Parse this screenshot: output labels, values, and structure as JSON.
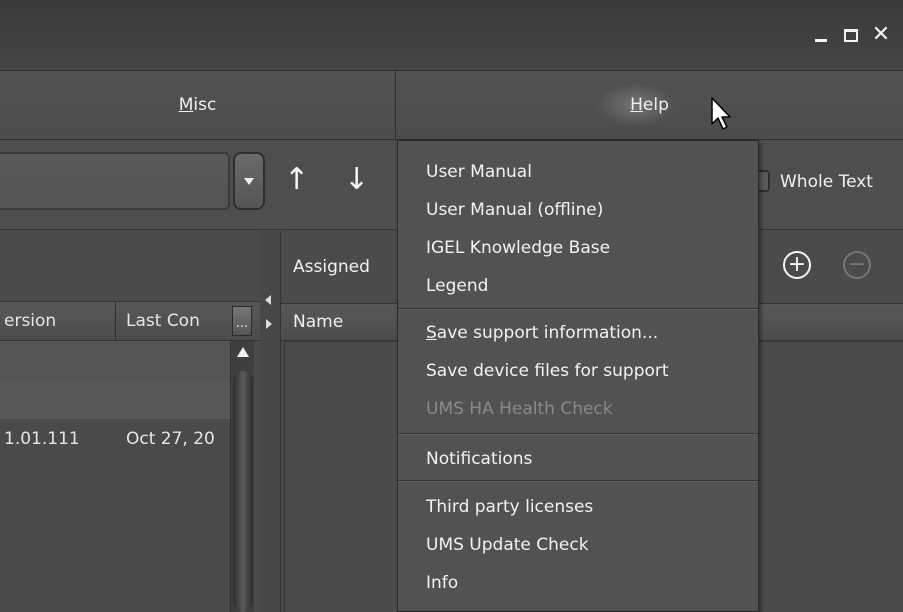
{
  "window": {
    "controls": {
      "minimize_icon": "minimize-icon",
      "maximize_icon": "maximize-icon",
      "close_glyph": "✕"
    }
  },
  "menubar": {
    "misc_label": "Misc",
    "help_label": "Help"
  },
  "toolbar": {
    "search_value": "",
    "up_arrow": "↑",
    "down_arrow": "↓",
    "whole_text_label": "Whole Text"
  },
  "left_table": {
    "columns": {
      "version": "ersion",
      "last_contact": "Last Con",
      "more": "..."
    },
    "row": {
      "version": "1.01.111",
      "date": "Oct 27, 20"
    }
  },
  "right_panel": {
    "assigned_label": "Assigned",
    "name_column": "Name",
    "add_glyph": "+",
    "remove_glyph": "−"
  },
  "help_menu": {
    "items": [
      {
        "label": "User Manual",
        "enabled": true
      },
      {
        "label": "User Manual (offline)",
        "enabled": true
      },
      {
        "label": "IGEL Knowledge Base",
        "enabled": true
      },
      {
        "label": "Legend",
        "enabled": true
      },
      {
        "label": "Save support information...",
        "enabled": true
      },
      {
        "label": "Save device files for support",
        "enabled": true
      },
      {
        "label": "UMS HA Health Check",
        "enabled": false
      },
      {
        "label": "Notifications",
        "enabled": true
      },
      {
        "label": "Third party licenses",
        "enabled": true
      },
      {
        "label": "UMS Update Check",
        "enabled": true
      },
      {
        "label": "Info",
        "enabled": true
      }
    ]
  },
  "colors": {
    "background": "#4a4a4a",
    "text": "#f2f2f2",
    "disabled_text": "#8a8a8a"
  }
}
